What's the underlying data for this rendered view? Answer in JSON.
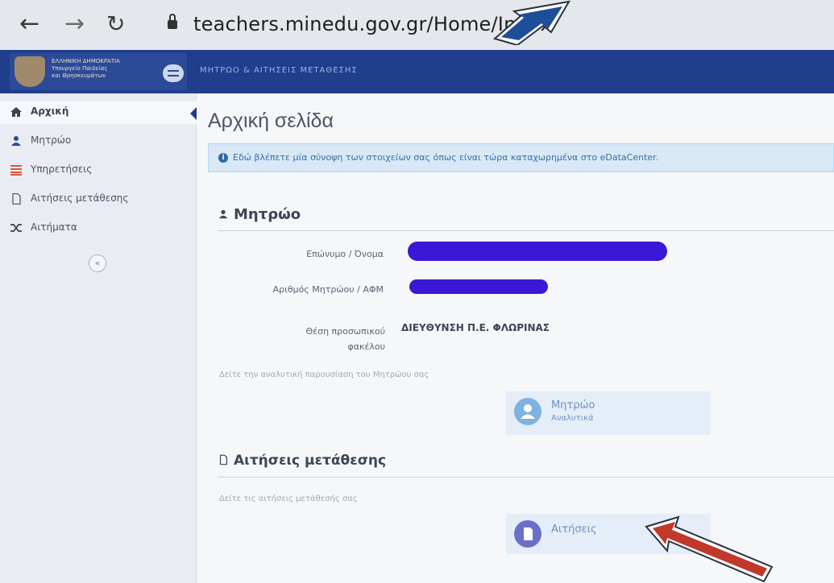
{
  "browser": {
    "url": "teachers.minedu.gov.gr/Home/Index"
  },
  "header": {
    "org_lines": [
      "ΕΛΛΗΝΙΚΗ ΔΗΜΟΚΡΑΤΙΑ",
      "Υπουργείο Παιδείας",
      "και Θρησκευμάτων"
    ],
    "app_title": "ΜΗΤΡΩΟ & ΑΙΤΗΣΕΙΣ ΜΕΤΑΘΕΣΗΣ"
  },
  "sidebar": {
    "items": [
      {
        "label": "Αρχική",
        "icon": "home-icon"
      },
      {
        "label": "Μητρώο",
        "icon": "user-icon"
      },
      {
        "label": "Υπηρετήσεις",
        "icon": "list-icon"
      },
      {
        "label": "Αιτήσεις μετάθεσης",
        "icon": "file-icon"
      },
      {
        "label": "Αιτήματα",
        "icon": "shuffle-icon"
      }
    ],
    "collapse_label": "«"
  },
  "main": {
    "page_title": "Αρχική σελίδα",
    "info_text": "Εδώ βλέπετε μία σύνοψη των στοιχείων σας όπως είναι τώρα καταχωρημένα στο eDataCenter.",
    "registry": {
      "heading": "Μητρώο",
      "fields": [
        {
          "label": "Επώνυμο / Όνομα",
          "value": ""
        },
        {
          "label": "Αριθμός Μητρώου / ΑΦΜ",
          "value": ""
        },
        {
          "label": "Θέση προσωπικού φακέλου",
          "value": "ΔΙΕΥΘΥΝΣΗ Π.Ε. ΦΛΩΡΙΝΑΣ"
        }
      ],
      "hint": "Δείτε την αναλυτική παρουσίαση του Μητρώου σας",
      "tile_title": "Μητρώο",
      "tile_subtitle": "Αναλυτικά"
    },
    "transfers": {
      "heading": "Αιτήσεις μετάθεσης",
      "hint": "Δείτε τις αιτήσεις μετάθεσής σας",
      "tile_title": "Αιτήσεις"
    }
  },
  "colors": {
    "topbar": "#1f3e8c",
    "sidebar": "#e9edf3",
    "info_bg": "#d9e8f6",
    "redaction": "#3a18d6",
    "annotation_arrow_top": "#1d4e9a",
    "annotation_arrow_bottom": "#c0392b"
  }
}
